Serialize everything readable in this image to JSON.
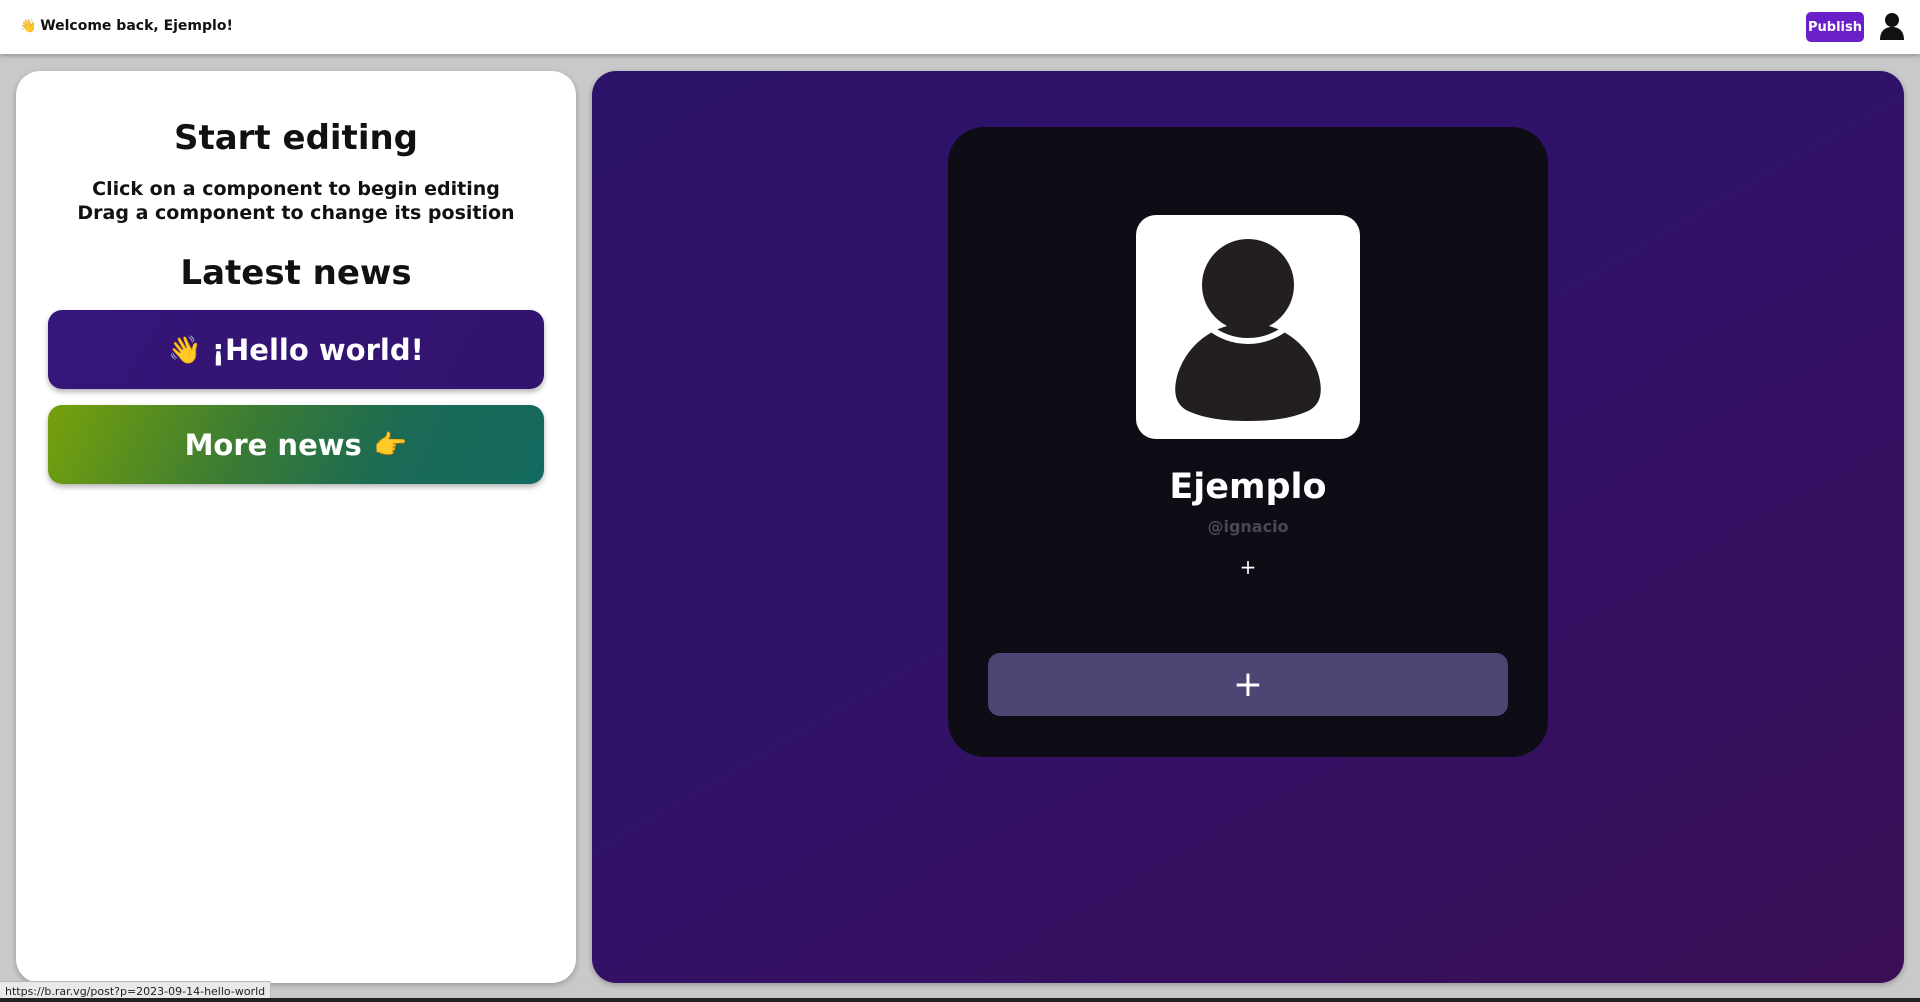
{
  "header": {
    "welcome_icon": "👋",
    "welcome_text": "Welcome back, Ejemplo!",
    "publish_label": "Publish",
    "accent_color": "#6a20c8"
  },
  "editor": {
    "title": "Start editing",
    "instruction_1": "Click on a component to begin editing",
    "instruction_2": "Drag a component to change its position",
    "news_title": "Latest news",
    "news_items": [
      {
        "emoji": "👋",
        "label": "¡Hello world!"
      },
      {
        "label": "More news",
        "emoji": "👉"
      }
    ]
  },
  "preview": {
    "name": "Ejemplo",
    "handle": "@ignacio",
    "small_add": "+",
    "big_add": "+"
  },
  "status_bar": {
    "url": "https://b.rar.vg/post?p=2023-09-14-hello-world"
  }
}
